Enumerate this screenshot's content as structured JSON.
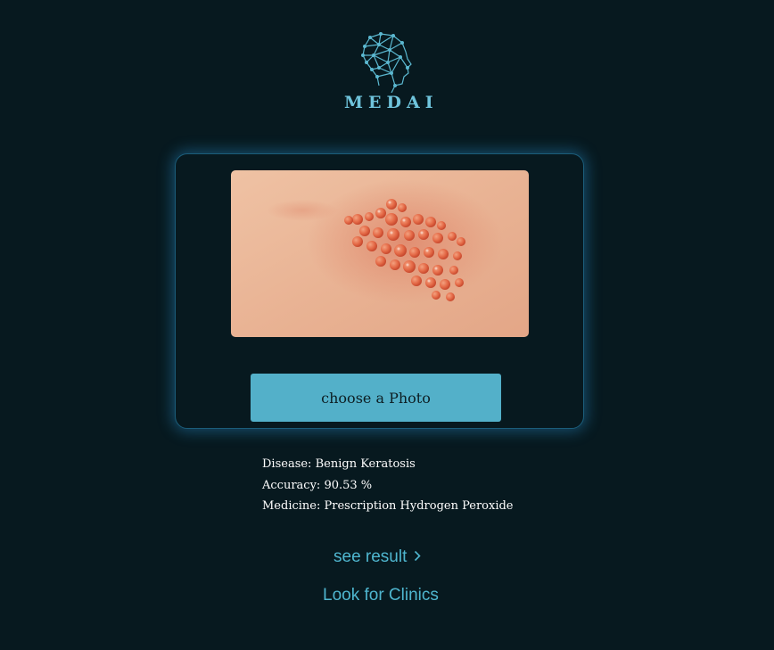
{
  "brand": {
    "name": "MEDAI",
    "icon": "ai-head-network-logo",
    "accent_color": "#6fc4dc"
  },
  "upload": {
    "image_description": "skin-lesion-photo",
    "choose_button_label": "choose a Photo",
    "button_color": "#53b0c9"
  },
  "result": {
    "disease_label": "Disease:",
    "disease_value": "Benign Keratosis",
    "accuracy_label": "Accuracy:",
    "accuracy_value": "90.53 %",
    "medicine_label": "Medicine:",
    "medicine_value": "Prescription Hydrogen Peroxide"
  },
  "actions": {
    "see_result_label": "see result",
    "see_result_icon": "chevron-right-icon",
    "clinics_label": "Look for Clinics"
  }
}
